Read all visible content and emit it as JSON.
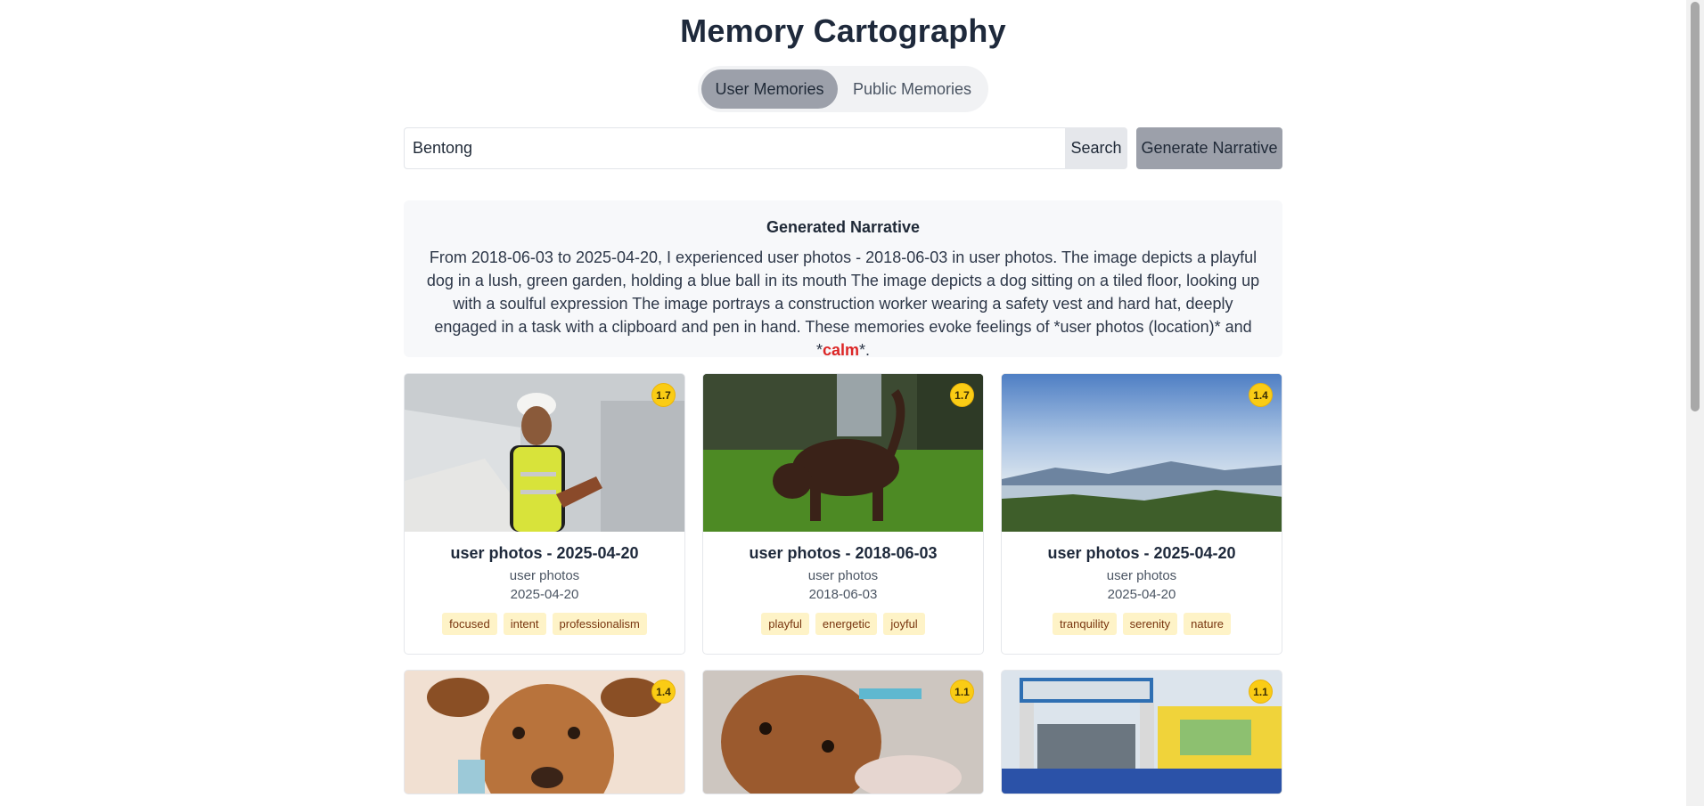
{
  "app": {
    "title": "Memory Cartography"
  },
  "toggle": {
    "user_label": "User Memories",
    "public_label": "Public Memories",
    "active": "user"
  },
  "search": {
    "value": "Bentong",
    "button_label": "Search",
    "generate_label": "Generate Narrative"
  },
  "narrative": {
    "title": "Generated Narrative",
    "text_before": "From 2018-06-03 to 2025-04-20, I experienced user photos - 2018-06-03 in user photos. The image depicts a playful dog in a lush, green garden, holding a blue ball in its mouth The image depicts a dog sitting on a tiled floor, looking up with a soulful expression The image portrays a construction worker wearing a safety vest and hard hat, deeply engaged in a task with a clipboard and pen in hand. These memories evoke feelings of *user photos (location)* and *",
    "mood_word": "calm",
    "text_after": "*."
  },
  "cards": [
    {
      "score": "1.7",
      "title": "user photos - 2025-04-20",
      "source": "user photos",
      "date": "2025-04-20",
      "tags": [
        "focused",
        "intent",
        "professionalism"
      ]
    },
    {
      "score": "1.7",
      "title": "user photos - 2018-06-03",
      "source": "user photos",
      "date": "2018-06-03",
      "tags": [
        "playful",
        "energetic",
        "joyful"
      ]
    },
    {
      "score": "1.4",
      "title": "user photos - 2025-04-20",
      "source": "user photos",
      "date": "2025-04-20",
      "tags": [
        "tranquility",
        "serenity",
        "nature"
      ]
    },
    {
      "score": "1.4"
    },
    {
      "score": "1.1"
    },
    {
      "score": "1.1"
    }
  ],
  "colors": {
    "accent_mood": "#dc2626",
    "badge": "#facc15",
    "tag_bg": "#fef3c7",
    "active_toggle": "#9ca0aa"
  }
}
